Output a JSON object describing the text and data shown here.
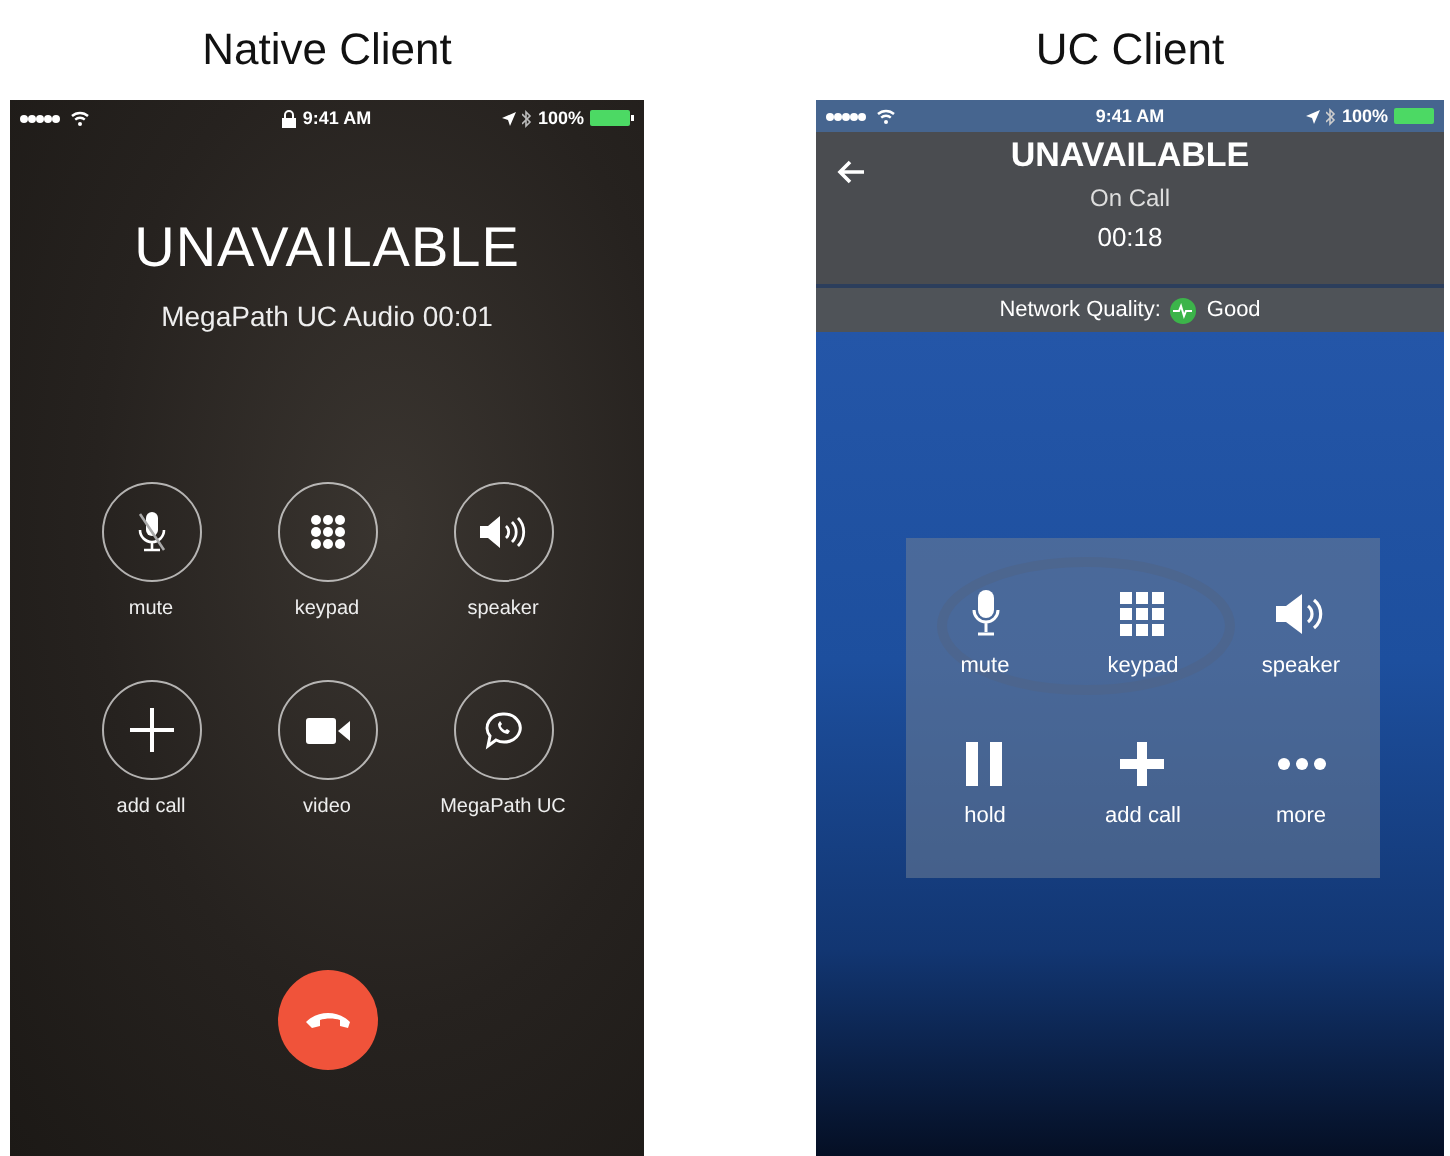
{
  "native_client": {
    "heading": "Native Client",
    "status_bar": {
      "time": "9:41 AM",
      "battery": "100%"
    },
    "title": "UNAVAILABLE",
    "subtitle": "MegaPath UC Audio 00:01",
    "buttons": [
      {
        "label": "mute",
        "kind": "mic-muted"
      },
      {
        "label": "keypad",
        "kind": "keypad"
      },
      {
        "label": "speaker",
        "kind": "speaker"
      },
      {
        "label": "add call",
        "kind": "plus"
      },
      {
        "label": "video",
        "kind": "video"
      },
      {
        "label": "MegaPath UC",
        "kind": "chat-phone"
      }
    ]
  },
  "uc_client": {
    "heading": "UC Client",
    "status_bar": {
      "time": "9:41 AM",
      "battery": "100%"
    },
    "title": "UNAVAILABLE",
    "status": "On Call",
    "timer": "00:18",
    "network_quality": {
      "label": "Network Quality:",
      "value": "Good"
    },
    "buttons": [
      {
        "label": "mute",
        "kind": "mic"
      },
      {
        "label": "keypad",
        "kind": "keypad"
      },
      {
        "label": "speaker",
        "kind": "speaker"
      },
      {
        "label": "hold",
        "kind": "pause"
      },
      {
        "label": "add call",
        "kind": "plus"
      },
      {
        "label": "more",
        "kind": "more"
      }
    ]
  }
}
